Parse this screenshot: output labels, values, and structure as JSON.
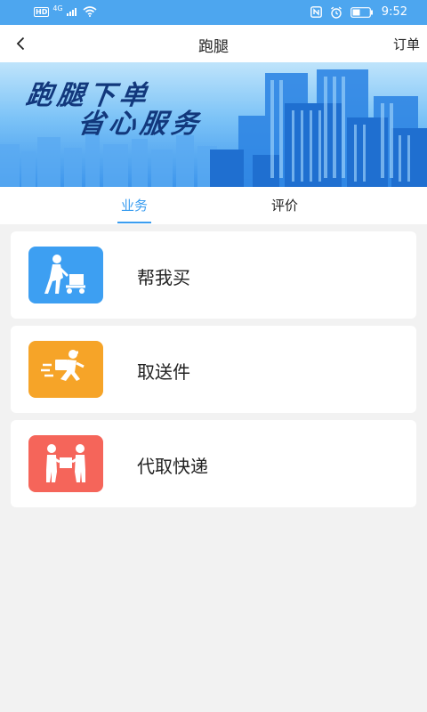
{
  "status_bar": {
    "network_badge": "HD",
    "signal_label": "4G",
    "time": "9:52"
  },
  "nav": {
    "title": "跑腿",
    "action": "订单"
  },
  "banner": {
    "line1": "跑腿下单",
    "line2": "省心服务"
  },
  "tabs": [
    {
      "label": "业务",
      "active": true
    },
    {
      "label": "评价",
      "active": false
    }
  ],
  "services": [
    {
      "label": "帮我买",
      "icon": "delivery-cart-icon",
      "color": "#3d9ff2"
    },
    {
      "label": "取送件",
      "icon": "running-courier-icon",
      "color": "#f6a428"
    },
    {
      "label": "代取快递",
      "icon": "package-handover-icon",
      "color": "#f5655a"
    }
  ]
}
